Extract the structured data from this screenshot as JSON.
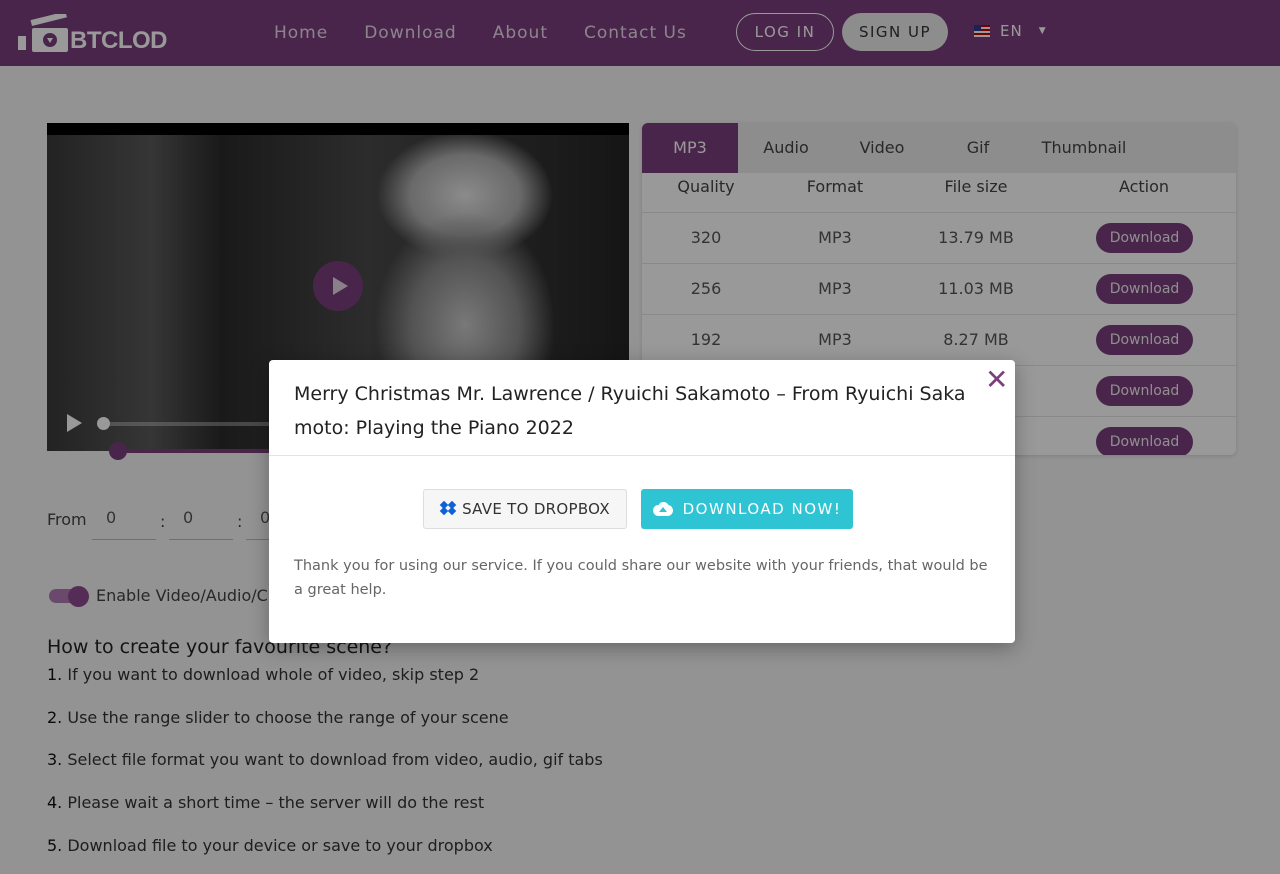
{
  "header": {
    "logo_text": "BTCLOD",
    "nav": [
      "Home",
      "Download",
      "About",
      "Contact Us"
    ],
    "login_label": "LOG IN",
    "signup_label": "SIGN UP",
    "language": "EN",
    "brand_color": "#7b3f7e"
  },
  "player": {
    "trim_from_label": "From",
    "from_hours": "0",
    "from_minutes": "0",
    "from_seconds": "0",
    "enable_label": "Enable Video/Audio/C"
  },
  "howto": {
    "title": "How to create your favourite scene?",
    "steps": [
      {
        "num": "1.",
        "text": "If you want to download whole of video, skip step 2"
      },
      {
        "num": "2.",
        "text": "Use the range slider to choose the range of your scene"
      },
      {
        "num": "3.",
        "text": "Select file format you want to download from video, audio, gif tabs"
      },
      {
        "num": "4.",
        "text": "Please wait a short time – the server will do the rest"
      },
      {
        "num": "5.",
        "text": "Download file to your device or save to your dropbox"
      }
    ]
  },
  "formats": {
    "tabs": [
      "MP3",
      "Audio",
      "Video",
      "Gif",
      "Thumbnail"
    ],
    "active_tab": "MP3",
    "columns": [
      "Quality",
      "Format",
      "File size",
      "Action"
    ],
    "rows": [
      {
        "quality": "320",
        "format": "MP3",
        "size": "13.79 MB",
        "action": "Download"
      },
      {
        "quality": "256",
        "format": "MP3",
        "size": "11.03 MB",
        "action": "Download"
      },
      {
        "quality": "192",
        "format": "MP3",
        "size": "8.27 MB",
        "action": "Download"
      },
      {
        "quality": "",
        "format": "",
        "size": "",
        "action": "Download"
      },
      {
        "quality": "",
        "format": "",
        "size": "",
        "action": "Download"
      }
    ]
  },
  "modal": {
    "title": "Merry Christmas Mr. Lawrence / Ryuichi Sakamoto – From Ryuichi Sakamoto: Playing the Piano 2022",
    "save_dropbox_label": "SAVE TO DROPBOX",
    "download_now_label": "DOWNLOAD NOW!",
    "message": "Thank you for using our service. If you could share our website with your friends, that would be a great help.",
    "accent_color": "#2fc4d4"
  }
}
